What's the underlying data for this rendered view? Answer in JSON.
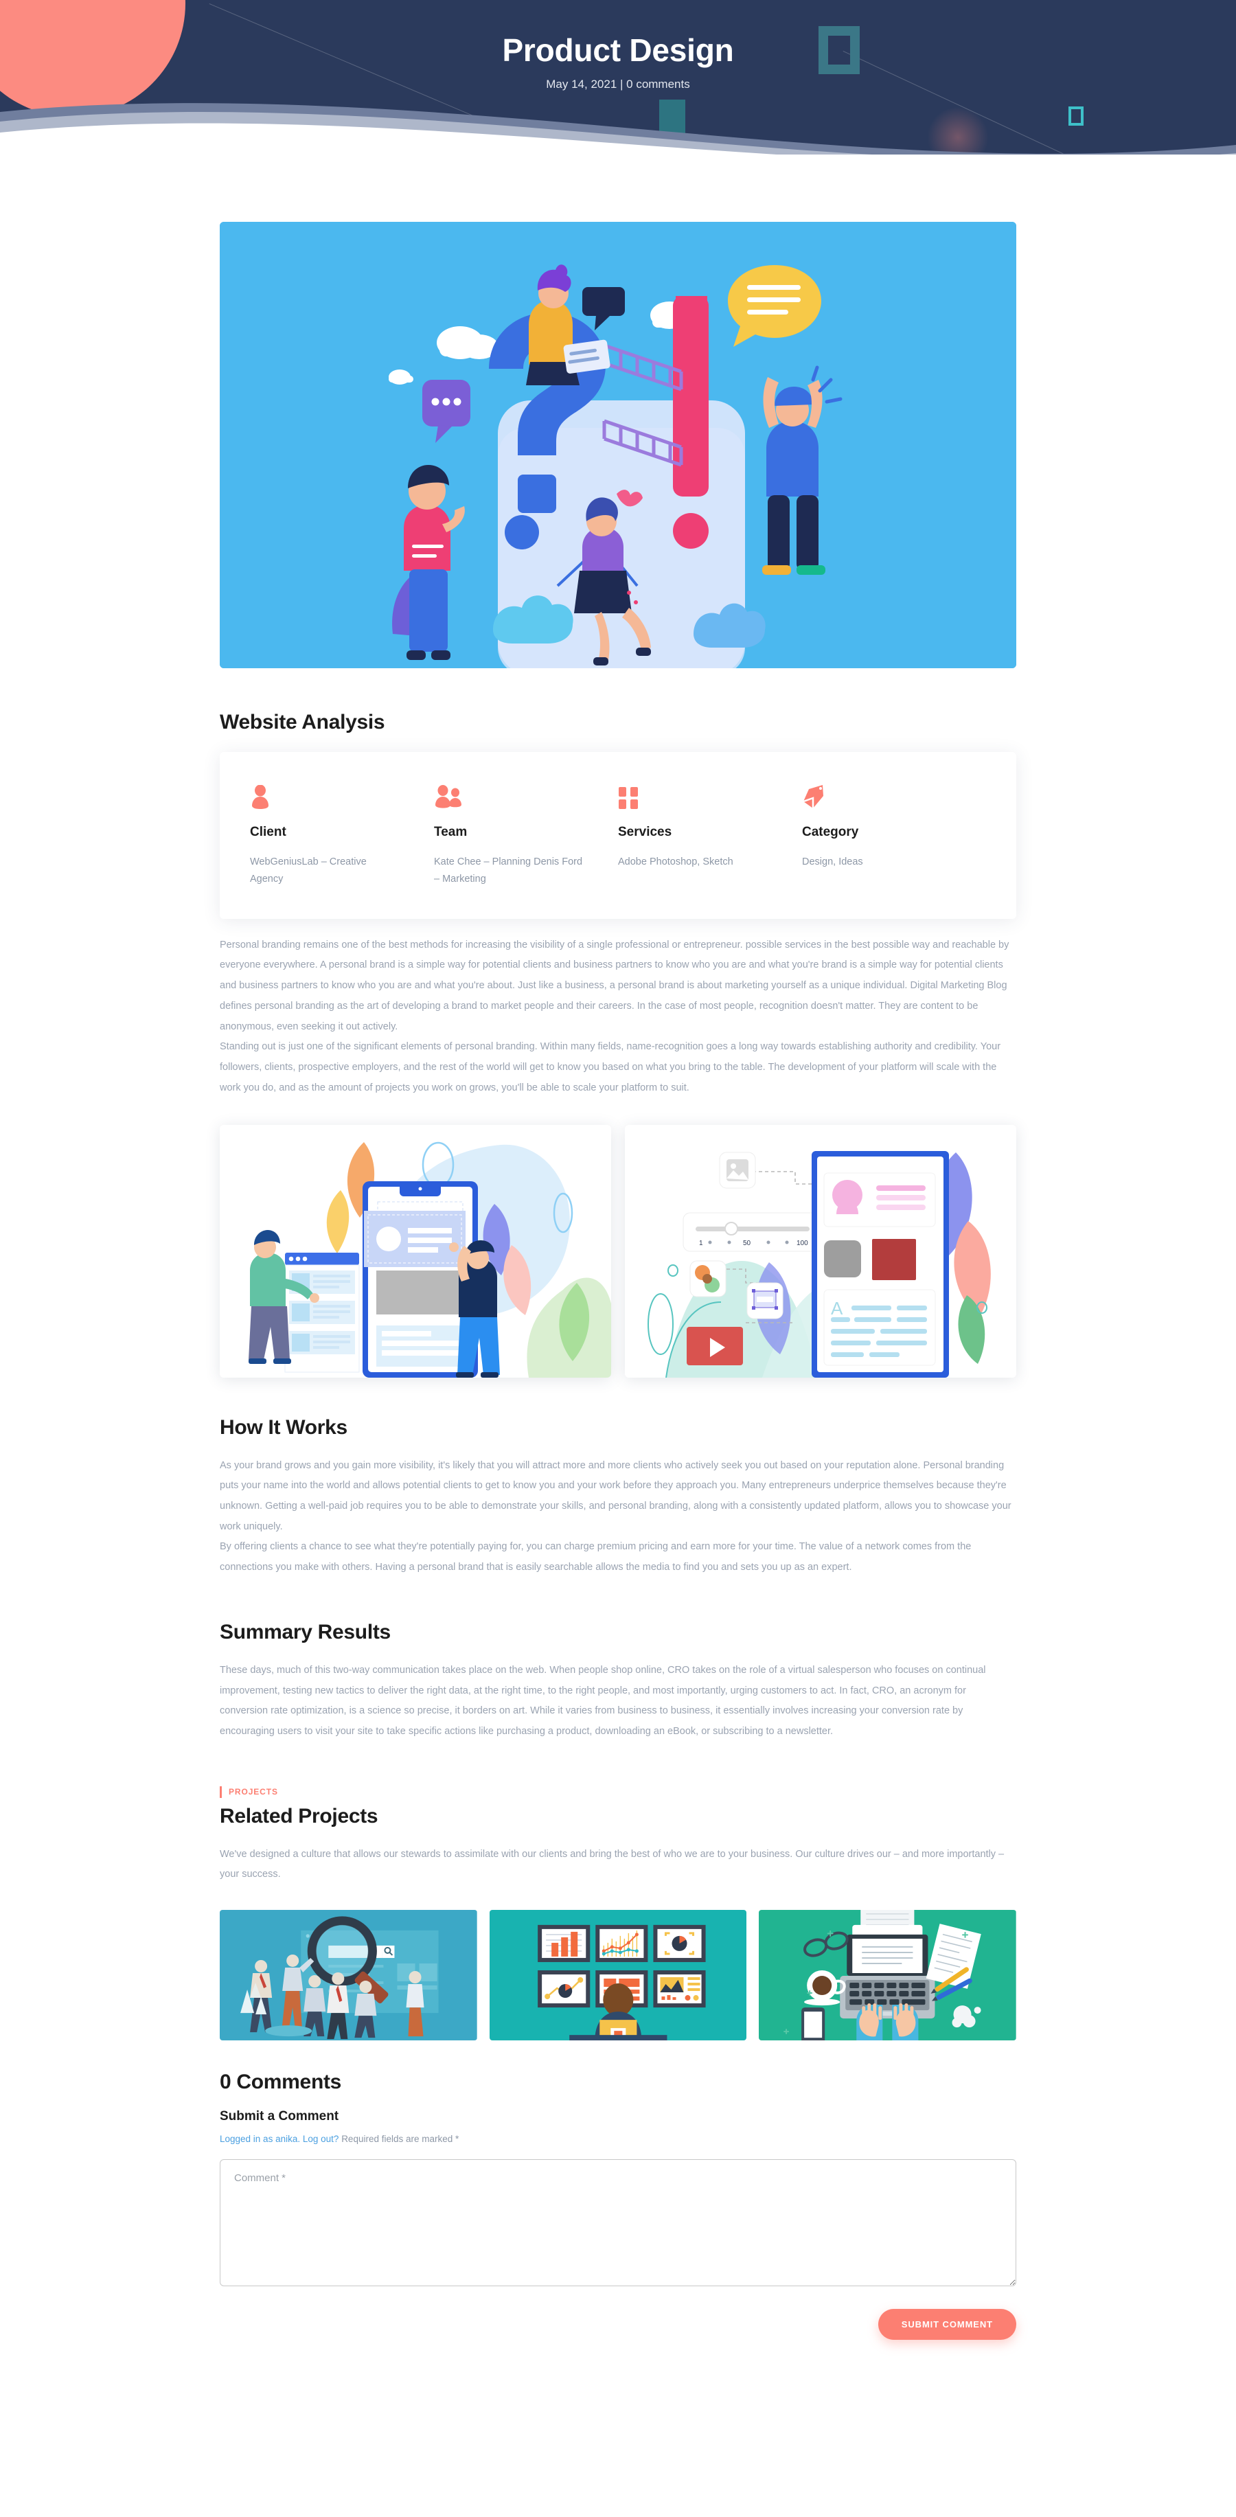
{
  "header": {
    "title": "Product Design",
    "meta": "May 14, 2021 | 0 comments",
    "bg_color": "#2b3a5c",
    "accent_color": "#fc8b81",
    "teal_color": "#3ec0c9"
  },
  "hero_figure": {
    "alt": "question-exclamation-illustration",
    "bg_color": "#4bb8ef"
  },
  "website_analysis": {
    "title": "Website Analysis",
    "items": [
      {
        "icon": "person-icon",
        "label": "Client",
        "value": "WebGeniusLab – Creative Agency"
      },
      {
        "icon": "people-icon",
        "label": "Team",
        "value": "Kate Chee – Planning Denis Ford – Marketing"
      },
      {
        "icon": "grid-icon",
        "label": "Services",
        "value": "Adobe Photoshop, Sketch"
      },
      {
        "icon": "tag-icon",
        "label": "Category",
        "value": "Design, Ideas"
      }
    ]
  },
  "intro": {
    "paragraph_1": "Personal branding remains one of the best methods for increasing the visibility of a single professional or entrepreneur. possible services in the best possible way and reachable by everyone everywhere. A personal brand is a simple way for potential clients and business partners to know who you are and what you're brand is a simple way for potential clients and business partners to know who you are and what you're about. Just like a business, a personal brand is about marketing yourself as a unique individual. Digital Marketing Blog defines personal branding as the art of developing a brand to market people and their careers. In the case of most people, recognition doesn't matter. They are content to be anonymous, even seeking it out actively.",
    "paragraph_2": "Standing out is just one of the significant elements of personal branding. Within many fields, name-recognition goes a long way towards establishing authority and credibility. Your followers, clients, prospective employers, and the rest of the world will get to know you based on what you bring to the table. The development of your platform will scale with the work you do, and as the amount of projects you work on grows, you'll be able to scale your platform to suit."
  },
  "gallery": {
    "image_1_alt": "ui-design-collaboration-illustration",
    "image_2_alt": "mobile-app-design-tools-illustration"
  },
  "how_it_works": {
    "title": "How It Works",
    "paragraph_1": "As your brand grows and you gain more visibility, it's likely that you will attract more and more clients who actively seek you out based on your reputation alone. Personal branding puts your name into the world and allows potential clients to get to know you and your work before they approach you. Many entrepreneurs underprice themselves because they're unknown. Getting a well-paid job requires you to be able to demonstrate your skills, and personal branding, along with a consistently updated platform, allows you to showcase your work uniquely.",
    "paragraph_2": "By offering clients a chance to see what they're potentially paying for, you can charge premium pricing and earn more for your time. The value of a network comes from the connections you make with others. Having a personal brand that is easily searchable allows the media to find you and sets you up as an expert."
  },
  "summary_results": {
    "title": "Summary Results",
    "paragraph_1": "These days, much of this two-way communication takes place on the web. When people shop online, CRO takes on the role of a virtual salesperson who focuses on continual improvement, testing new tactics to deliver the right data, at the right time, to the right people, and most importantly, urging customers to act. In fact, CRO, an acronym for conversion rate optimization, is a science so precise, it borders on art. While it varies from business to business, it essentially involves increasing your conversion rate by encouraging users to visit your site to take specific actions like purchasing a product, downloading an eBook, or subscribing to a newsletter."
  },
  "related_projects": {
    "eyebrow": "PROJECTS",
    "title": "Related Projects",
    "description": "We've designed a culture that allows our stewards to assimilate with our clients and bring the best of who we are to your business. Our culture drives our – and more importantly – your success.",
    "cards": [
      {
        "alt": "seo-search-team-illustration",
        "bg_color": "#3ca8c6"
      },
      {
        "alt": "analytics-dashboard-illustration",
        "bg_color": "#18b3b0"
      },
      {
        "alt": "laptop-writing-desk-illustration",
        "bg_color": "#21b491"
      }
    ]
  },
  "comments": {
    "count_title": "0 Comments",
    "submit_title": "Submit a Comment",
    "logged_in_prefix": "Logged in as anika.",
    "logout_label": "Log out?",
    "required_note": "Required fields are marked *",
    "comment_placeholder": "Comment *",
    "submit_label": "Submit Comment"
  }
}
